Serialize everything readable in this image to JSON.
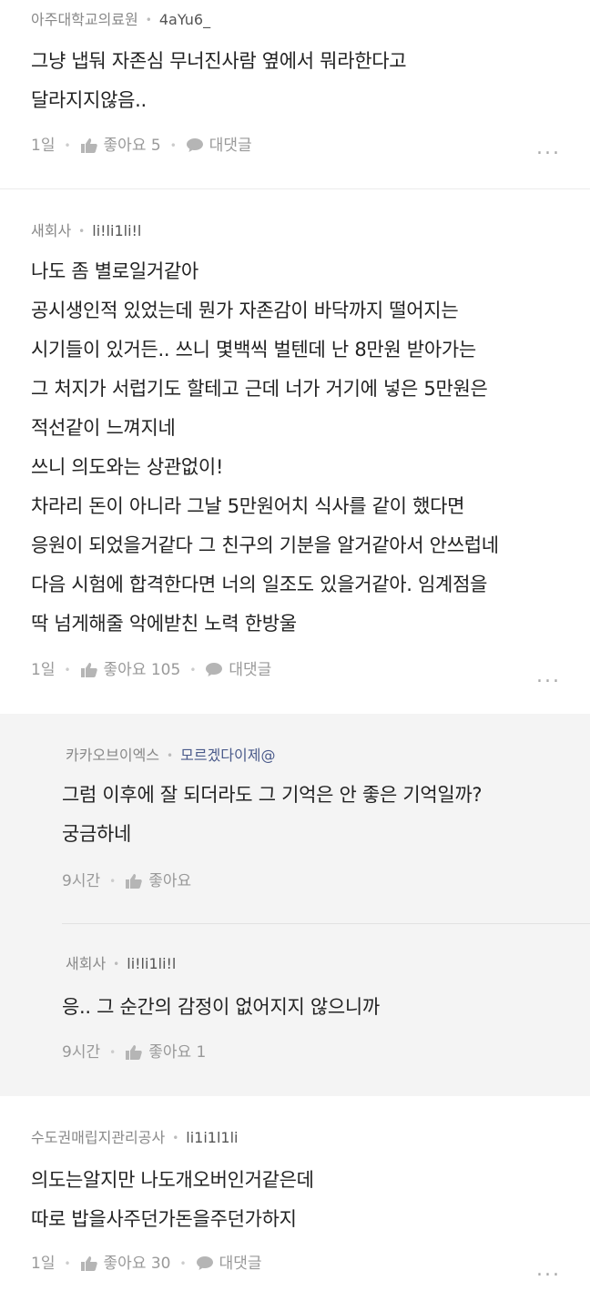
{
  "comments": [
    {
      "org": "아주대학교의료원",
      "nick": "4aYu6_",
      "lines": [
        "그냥 냅둬 자존심 무너진사람 옆에서 뭐라한다고",
        "달라지지않음.."
      ],
      "time": "1일",
      "like": "좋아요 5",
      "reply": "대댓글",
      "more": "..."
    },
    {
      "org": "새회사",
      "nick": "li!li1li!l",
      "lines": [
        "나도 좀 별로일거같아",
        "공시생인적 있었는데 뭔가 자존감이 바닥까지 떨어지는",
        "시기들이 있거든.. 쓰니 몇백씩 벌텐데 난 8만원 받아가는",
        "그 처지가 서럽기도 할테고 근데 너가 거기에 넣은 5만원은",
        "적선같이 느껴지네",
        "쓰니 의도와는 상관없이!",
        "차라리 돈이 아니라 그날 5만원어치 식사를 같이 했다면",
        "응원이 되었을거같다 그 친구의 기분을 알거같아서 안쓰럽네",
        "다음 시험에 합격한다면 너의 일조도 있을거같아. 임계점을",
        "딱 넘게해줄 악에받친 노력 한방울"
      ],
      "time": "1일",
      "like": "좋아요 105",
      "reply": "대댓글",
      "more": "..."
    },
    {
      "org": "수도권매립지관리공사",
      "nick": "li1i1l1li",
      "lines": [
        "의도는알지만 나도개오버인거같은데",
        "따로 밥을사주던가돈을주던가하지"
      ],
      "time": "1일",
      "like": "좋아요 30",
      "reply": "대댓글",
      "more": "..."
    }
  ],
  "replies": [
    {
      "org": "카카오브이엑스",
      "nick": "모르겠다이제@",
      "lines": [
        "그럼 이후에 잘 되더라도 그 기억은 안 좋은 기억일까?",
        "궁금하네"
      ],
      "time": "9시간",
      "like": "좋아요"
    },
    {
      "org": "새회사",
      "nick": "li!li1li!l",
      "lines": [
        "응.. 그 순간의 감정이 없어지지 않으니까"
      ],
      "time": "9시간",
      "like": "좋아요 1"
    }
  ]
}
